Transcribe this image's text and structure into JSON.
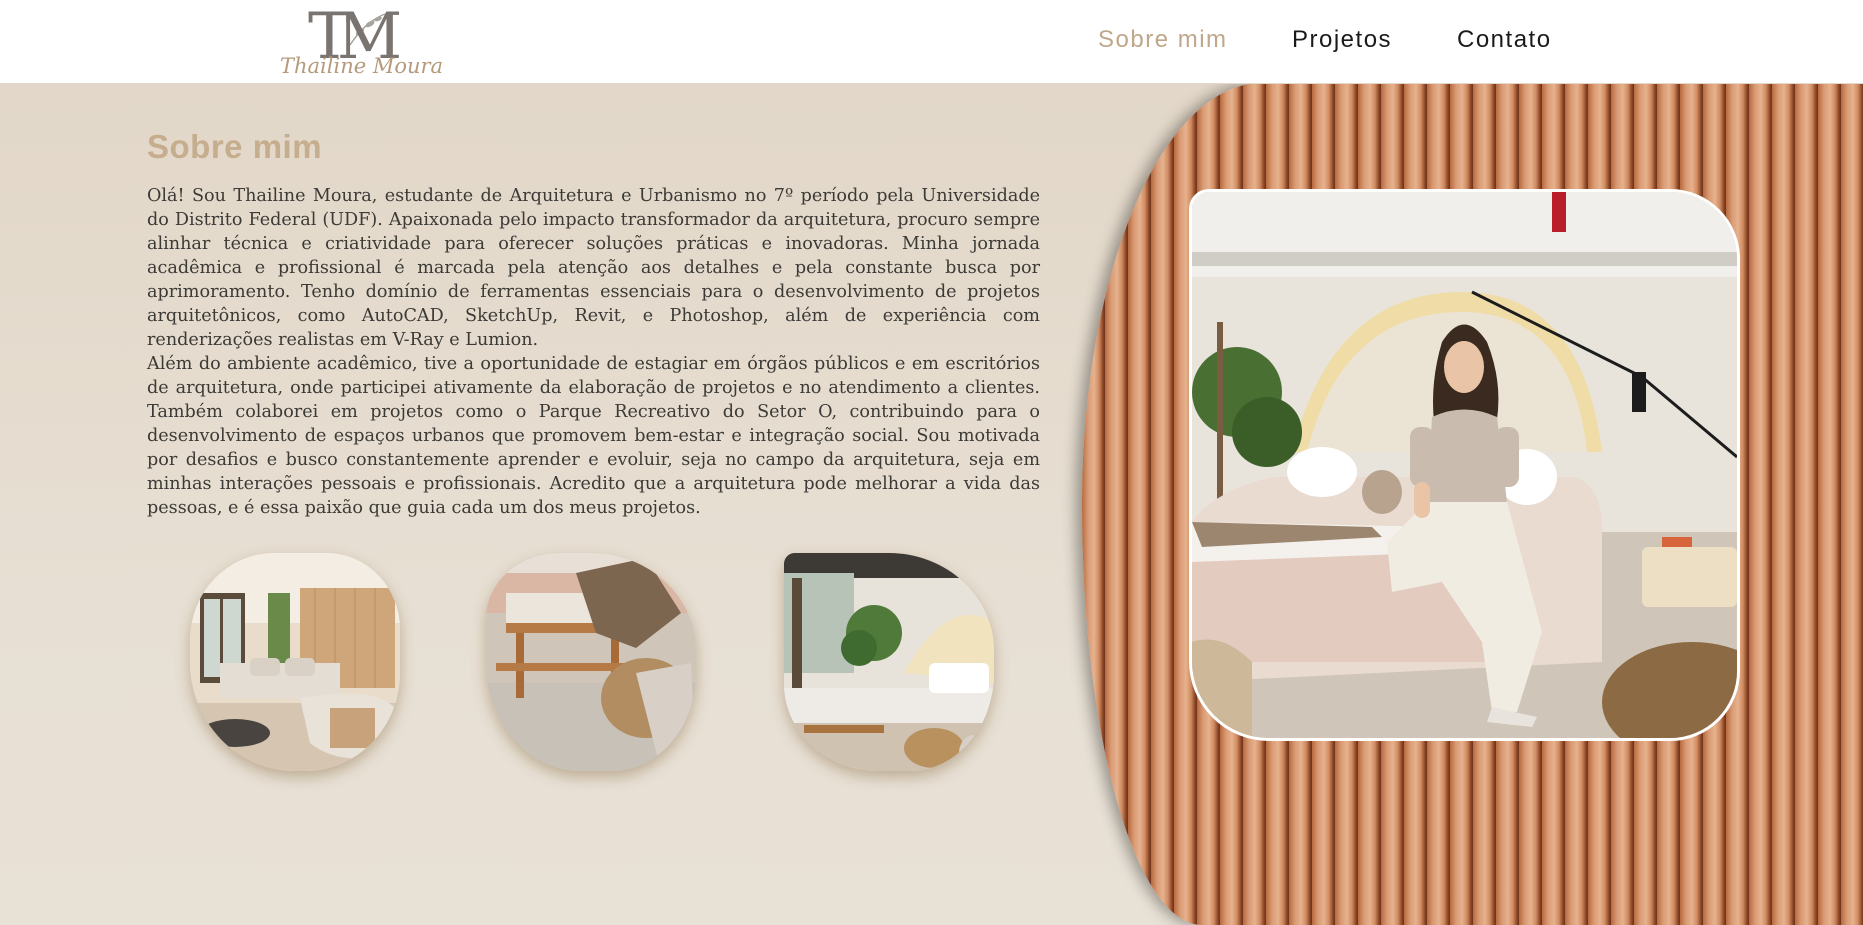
{
  "header": {
    "logo_monogram": "TM",
    "logo_name": "Thailine Moura",
    "nav": [
      {
        "label": "Sobre mim",
        "active": true
      },
      {
        "label": "Projetos",
        "active": false
      },
      {
        "label": "Contato",
        "active": false
      }
    ]
  },
  "about": {
    "title": "Sobre mim",
    "paragraphs": [
      "Olá! Sou Thailine Moura, estudante de Arquitetura e Urbanismo no 7º período pela Universidade do Distrito Federal (UDF). Apaixonada pelo impacto transformador da arquitetura, procuro sempre alinhar técnica e criatividade para oferecer soluções práticas e inovadoras. Minha jornada acadêmica e profissional é marcada pela atenção aos detalhes e pela constante busca por aprimoramento. Tenho domínio de ferramentas essenciais para o desenvolvimento de projetos arquitetônicos, como AutoCAD, SketchUp, Revit, e Photoshop, além de experiência com renderizações realistas em V-Ray e Lumion.",
      "Além do ambiente acadêmico, tive a oportunidade de estagiar em órgãos públicos e em escritórios de arquitetura, onde participei ativamente da elaboração de projetos e no atendimento a clientes. Também colaborei em projetos como o Parque Recreativo do Setor O, contribuindo para o desenvolvimento de espaços urbanos que promovem bem-estar e integração social. Sou motivada por desafios e busco constantemente aprender e evoluir, seja no campo da arquitetura, seja em minhas interações pessoais e profissionais. Acredito que a arquitetura pode melhorar a vida das pessoas, e é essa paixão que guia cada um dos meus projetos."
    ]
  },
  "colors": {
    "accent": "#bfa78b",
    "background": "#e6ddd0",
    "wood": "#c77c52"
  }
}
